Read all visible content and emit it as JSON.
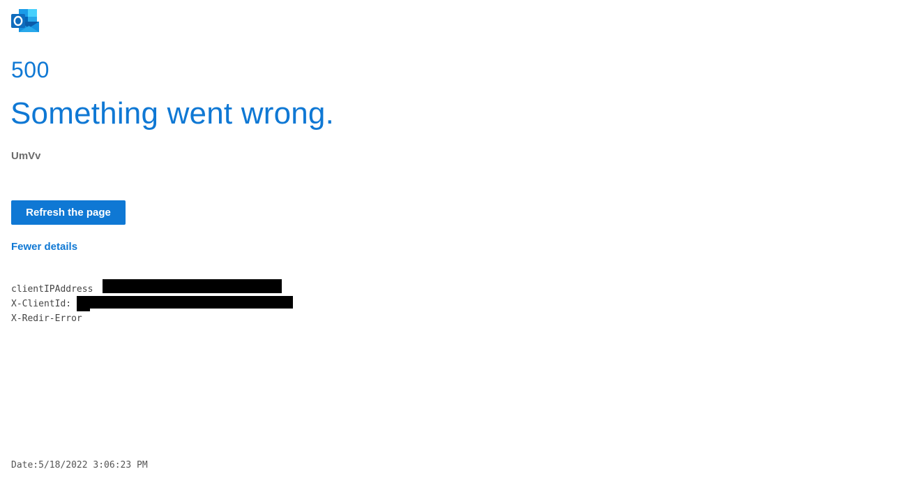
{
  "app": {
    "logo_icon": "outlook-logo-icon",
    "accent_color": "#0f78d4"
  },
  "error": {
    "code": "500",
    "title": "Something went wrong.",
    "detail": "UmVv"
  },
  "actions": {
    "refresh_label": "Refresh the page",
    "details_toggle_label": "Fewer details"
  },
  "diagnostics": {
    "client_ip_label": "clientIPAddress",
    "client_id_label": "X-ClientId:",
    "redir_error_label": "X-Redir-Error",
    "date_text": "Date:5/18/2022 3:06:23 PM"
  }
}
